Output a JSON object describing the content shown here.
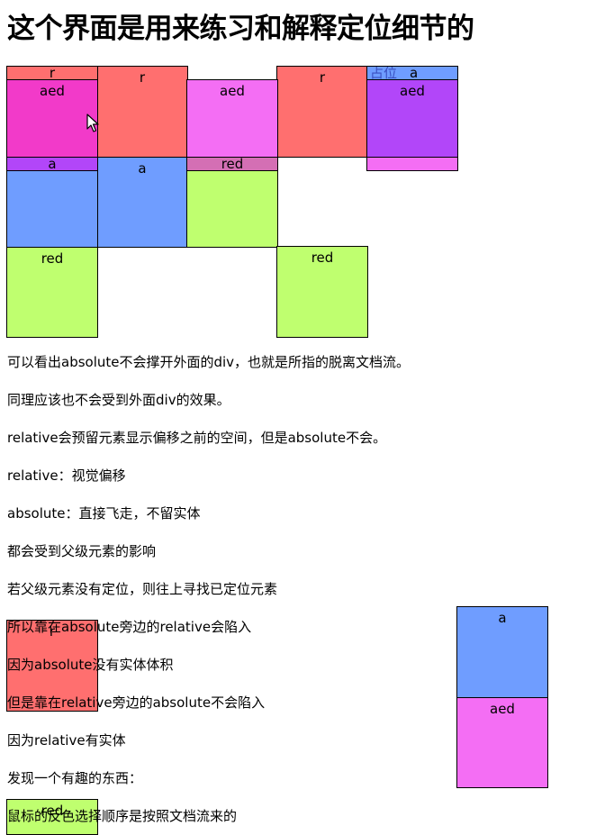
{
  "page_title": "这个界面是用来练习和解释定位细节的",
  "box_labels": {
    "r": "r",
    "aed": "aed",
    "a": "a",
    "red": "red"
  },
  "positioned_text": "占位",
  "paragraphs": [
    "可以看出absolute不会撑开外面的div，也就是所指的脱离文档流。",
    "同理应该也不会受到外面div的效果。",
    "relative会预留元素显示偏移之前的空间，但是absolute不会。",
    "relative：视觉偏移",
    "absolute：直接飞走，不留实体",
    "都会受到父级元素的影响",
    "若父级元素没有定位，则往上寻找已定位元素",
    "所以靠在absolute旁边的relative会陷入",
    "因为absolute没有实体体积",
    "但是靠在relative旁边的absolute不会陷入",
    "因为relative有实体",
    "发现一个有趣的东西：",
    "鼠标的反色选择顺序是按照文档流来的"
  ],
  "colors": {
    "r": "#ff6f6f",
    "aed": "#f46ef4",
    "a": "#6f9dff",
    "red": "#bfff6f"
  }
}
